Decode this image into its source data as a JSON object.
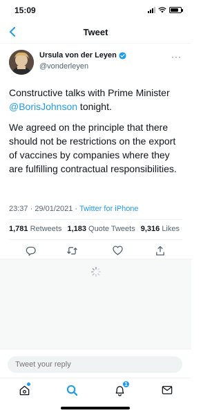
{
  "status_bar": {
    "time": "15:09"
  },
  "header": {
    "title": "Tweet"
  },
  "author": {
    "name": "Ursula von der Leyen",
    "handle": "@vonderleyen",
    "more": "···"
  },
  "tweet": {
    "line1_prefix": "Constructive talks with Prime Minister ",
    "mention": "@BorisJohnson",
    "line1_suffix": " tonight.",
    "paragraph2": "We agreed on the principle that there should not be restrictions on the export of vaccines by companies where they are fulfilling contractual responsibilities."
  },
  "meta": {
    "time": "23:37",
    "separator": " · ",
    "date": "29/01/2021",
    "separator2": " · ",
    "source": "Twitter for iPhone"
  },
  "stats": {
    "retweets_count": "1,781",
    "retweets_label": "Retweets",
    "quotes_count": "1,183",
    "quotes_label": "Quote Tweets",
    "likes_count": "9,316",
    "likes_label": "Likes"
  },
  "reply": {
    "placeholder": "Tweet your reply"
  },
  "tabbar": {
    "notifications_count": "1"
  },
  "colors": {
    "accent": "#1d9bf0",
    "text": "#0f1419",
    "muted": "#536471",
    "divider": "#eff3f4"
  },
  "icons": {
    "back": "chevron-left-icon",
    "verified": "verified-badge-icon",
    "reply": "reply-icon",
    "retweet": "retweet-icon",
    "like": "heart-icon",
    "share": "share-icon",
    "loading": "spinner-icon",
    "home": "home-icon",
    "search": "search-icon",
    "notifications": "bell-icon",
    "messages": "mail-icon"
  }
}
